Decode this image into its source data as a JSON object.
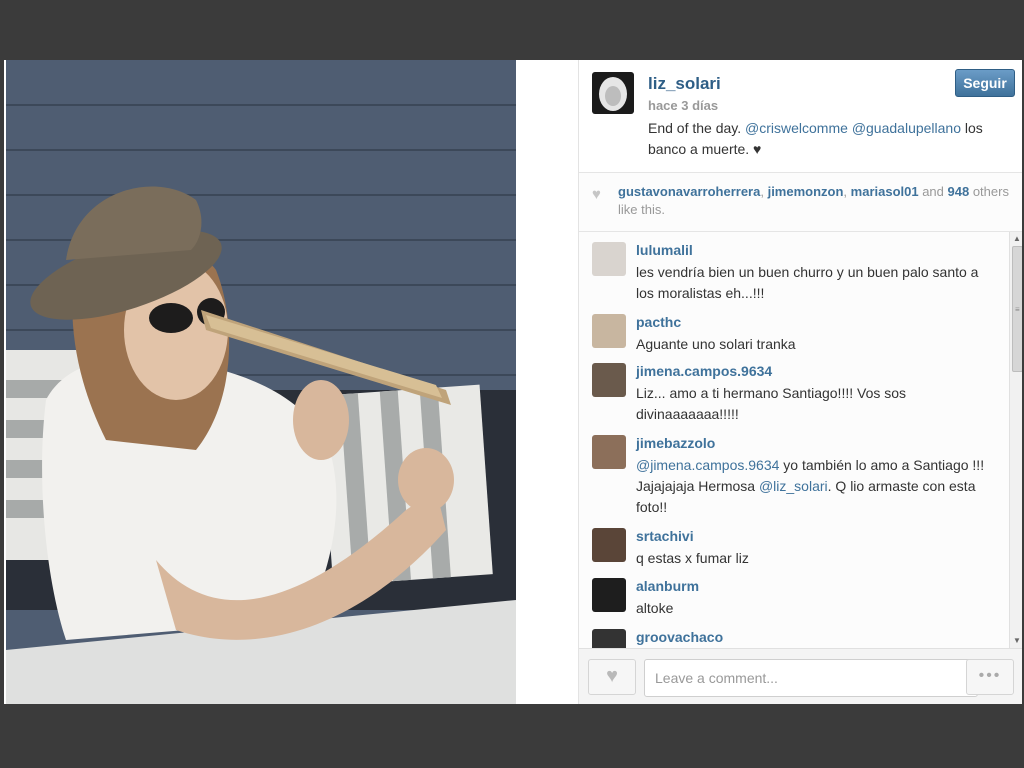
{
  "post": {
    "username": "liz_solari",
    "time": "hace 3 días",
    "follow_label": "Seguir",
    "caption_parts": {
      "prefix": "End of the day. ",
      "mention1": "@criswelcomme",
      "mention2": "@guadalupellano",
      "suffix": " los banco a muerte. ♥"
    },
    "photo_icon": "woman-with-hat-photo"
  },
  "likes": {
    "heart_icon": "heart-icon",
    "user1": "gustavonavarroherrera",
    "sep1": ", ",
    "user2": "jimemonzon",
    "sep2": ", ",
    "user3": "mariasol01",
    "and_text": " and ",
    "count": "948",
    "suffix": " others like this."
  },
  "comments": [
    {
      "user": "lulumalil",
      "text": "les vendría bien un buen churro y un buen palo santo a los moralistas eh...!!!"
    },
    {
      "user": "pacthc",
      "text": "Aguante uno solari tranka"
    },
    {
      "user": "jimena.campos.9634",
      "text": "Liz... amo a ti hermano Santiago!!!! Vos sos divinaaaaaaa!!!!!"
    },
    {
      "user": "jimebazzolo",
      "mention": "@jimena.campos.9634",
      "text": " yo también lo amo a Santiago !!! Jajajajaja Hermosa ",
      "mention2": "@liz_solari",
      "text2": ". Q lio armaste con esta foto!!"
    },
    {
      "user": "srtachivi",
      "text": "q estas x fumar liz"
    },
    {
      "user": "alanburm",
      "text": "altoke"
    },
    {
      "user": "groovachaco",
      "text": ""
    }
  ],
  "footer": {
    "comment_placeholder": "Leave a comment...",
    "more_label": "•••",
    "like_icon": "heart-icon"
  },
  "colors": {
    "link": "#3f729b",
    "follow_button": "#3f729b",
    "backdrop": "#3b3b3b"
  }
}
